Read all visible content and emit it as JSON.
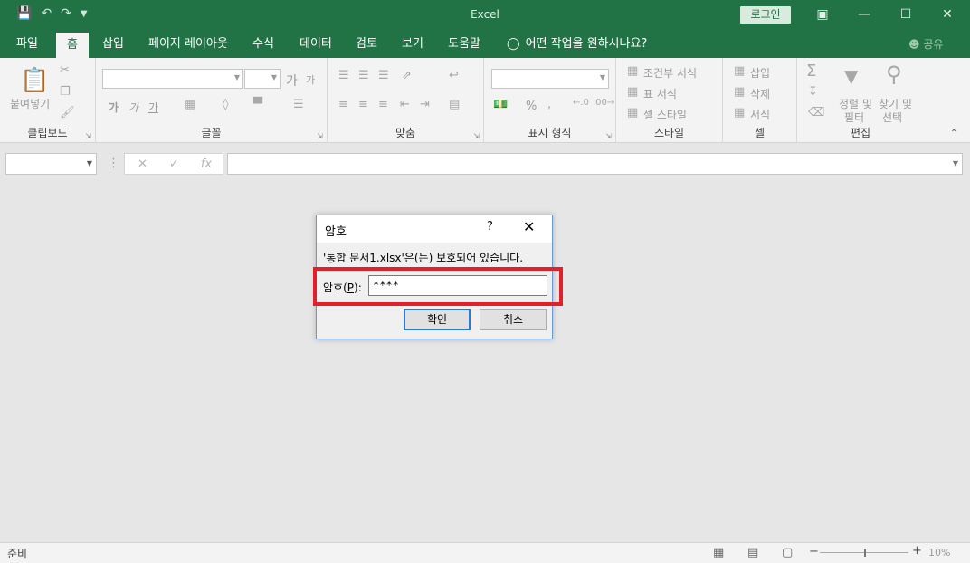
{
  "window": {
    "title": "Excel",
    "login_label": "로그인",
    "min": "—",
    "max": "☐",
    "close": "✕"
  },
  "tabs": [
    "파일",
    "홈",
    "삽입",
    "페이지 레이아웃",
    "수식",
    "데이터",
    "검토",
    "보기",
    "도움말"
  ],
  "tell_me": "어떤 작업을 원하시나요?",
  "share": "공유",
  "ribbon": {
    "clipboard": {
      "label": "클립보드",
      "paste": "붙여넣기"
    },
    "font": {
      "label": "글꼴",
      "grow": "가",
      "shrink": "가",
      "bold": "가",
      "italic": "가",
      "underline": "가"
    },
    "alignment": {
      "label": "맞춤"
    },
    "number": {
      "label": "표시 형식",
      "percent": "%"
    },
    "styles": {
      "label": "스타일",
      "conditional": "조건부 서식",
      "table": "표 서식",
      "cell": "셀 스타일"
    },
    "cells": {
      "label": "셀",
      "insert": "삽입",
      "delete": "삭제",
      "format": "서식"
    },
    "editing": {
      "label": "편집",
      "sort1": "정렬 및",
      "sort2": "필터",
      "find1": "찾기 및",
      "find2": "선택"
    }
  },
  "formula_bar": {
    "cancel": "✕",
    "enter": "✓",
    "fx": "fx"
  },
  "status": {
    "ready": "준비",
    "zoom": "10%"
  },
  "dialog": {
    "title": "암호",
    "help": "?",
    "message": "'통합 문서1.xlsx'은(는) 보호되어 있습니다.",
    "pw_label_prefix": "암호(",
    "pw_label_key": "P",
    "pw_label_suffix": "):",
    "pw_value": "****",
    "ok": "확인",
    "cancel": "취소"
  },
  "colors": {
    "accent": "#217346",
    "highlight": "#e2202c",
    "dialog_border": "#6b9bd1"
  }
}
